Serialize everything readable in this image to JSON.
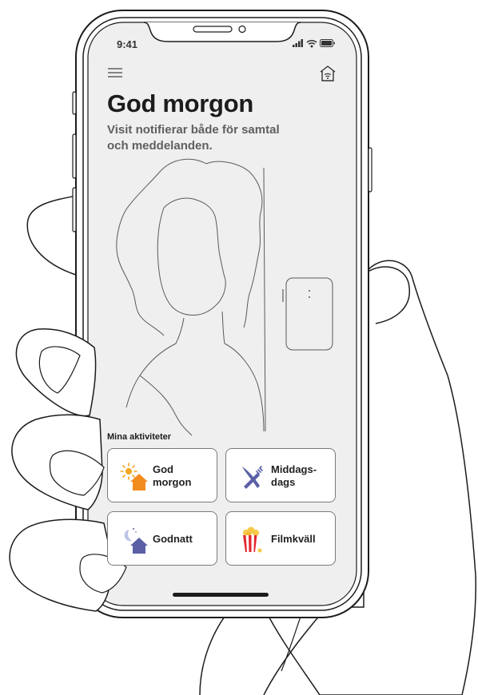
{
  "status_bar": {
    "time": "9:41"
  },
  "header": {
    "menu_icon": "hamburger-menu-icon",
    "home_icon": "smart-home-wifi-icon"
  },
  "hero": {
    "title": "God morgon",
    "subtitle": "Visit notifierar både för samtal och meddelanden."
  },
  "activities": {
    "section_label": "Mina aktiviteter",
    "items": [
      {
        "label_line1": "God",
        "label_line2": "morgon",
        "icon": "sun-house-icon"
      },
      {
        "label_line1": "Middags-",
        "label_line2": "dags",
        "icon": "fork-knife-icon"
      },
      {
        "label_line1": "Godnatt",
        "label_line2": "",
        "icon": "moon-house-icon"
      },
      {
        "label_line1": "Filmkväll",
        "label_line2": "",
        "icon": "popcorn-icon"
      }
    ]
  },
  "colors": {
    "accent_orange": "#f28c1e",
    "accent_blue": "#5a5fa6",
    "accent_red": "#e2262f",
    "screen_bg": "#efefef"
  }
}
